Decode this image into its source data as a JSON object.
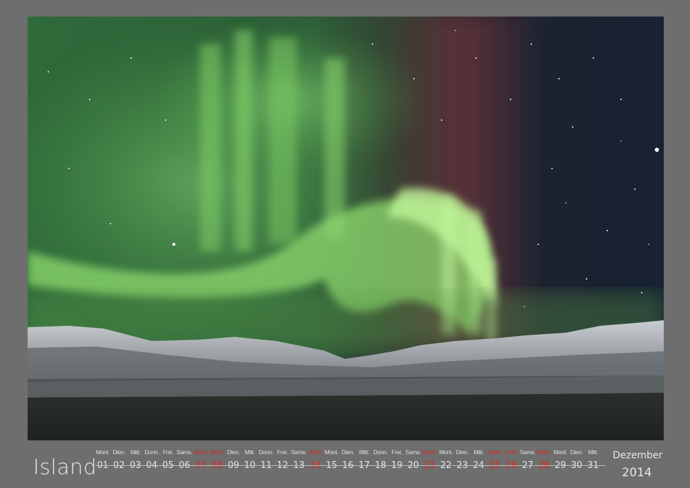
{
  "calendar": {
    "title": "Island",
    "month": "Dezember",
    "year": "2014",
    "accent_color": "#e4231c",
    "days": [
      {
        "wd": "Mont.",
        "num": "01",
        "red": false
      },
      {
        "wd": "Dien.",
        "num": "02",
        "red": false
      },
      {
        "wd": "Mitt.",
        "num": "03",
        "red": false
      },
      {
        "wd": "Donn.",
        "num": "04",
        "red": false
      },
      {
        "wd": "Frei.",
        "num": "05",
        "red": false
      },
      {
        "wd": "Sams.",
        "num": "06",
        "red": false
      },
      {
        "wd": "Sonn.",
        "num": "07",
        "red": true
      },
      {
        "wd": "Mont.",
        "num": "08",
        "red": true
      },
      {
        "wd": "Dien.",
        "num": "09",
        "red": false
      },
      {
        "wd": "Mitt.",
        "num": "10",
        "red": false
      },
      {
        "wd": "Donn.",
        "num": "11",
        "red": false
      },
      {
        "wd": "Frei.",
        "num": "12",
        "red": false
      },
      {
        "wd": "Sams.",
        "num": "13",
        "red": false
      },
      {
        "wd": "Sonn.",
        "num": "14",
        "red": true
      },
      {
        "wd": "Mont.",
        "num": "15",
        "red": false
      },
      {
        "wd": "Dien.",
        "num": "16",
        "red": false
      },
      {
        "wd": "Mitt.",
        "num": "17",
        "red": false
      },
      {
        "wd": "Donn.",
        "num": "18",
        "red": false
      },
      {
        "wd": "Frei.",
        "num": "19",
        "red": false
      },
      {
        "wd": "Sams.",
        "num": "20",
        "red": false
      },
      {
        "wd": "Sonn.",
        "num": "21",
        "red": true
      },
      {
        "wd": "Mont.",
        "num": "22",
        "red": false
      },
      {
        "wd": "Dien.",
        "num": "23",
        "red": false
      },
      {
        "wd": "Mitt.",
        "num": "24",
        "red": false
      },
      {
        "wd": "Donn.",
        "num": "25",
        "red": true
      },
      {
        "wd": "Frei.",
        "num": "26",
        "red": true
      },
      {
        "wd": "Sams.",
        "num": "27",
        "red": false
      },
      {
        "wd": "Sonn.",
        "num": "28",
        "red": true
      },
      {
        "wd": "Mont.",
        "num": "29",
        "red": false
      },
      {
        "wd": "Dien.",
        "num": "30",
        "red": false
      },
      {
        "wd": "Mitt.",
        "num": "31",
        "red": false
      }
    ]
  }
}
